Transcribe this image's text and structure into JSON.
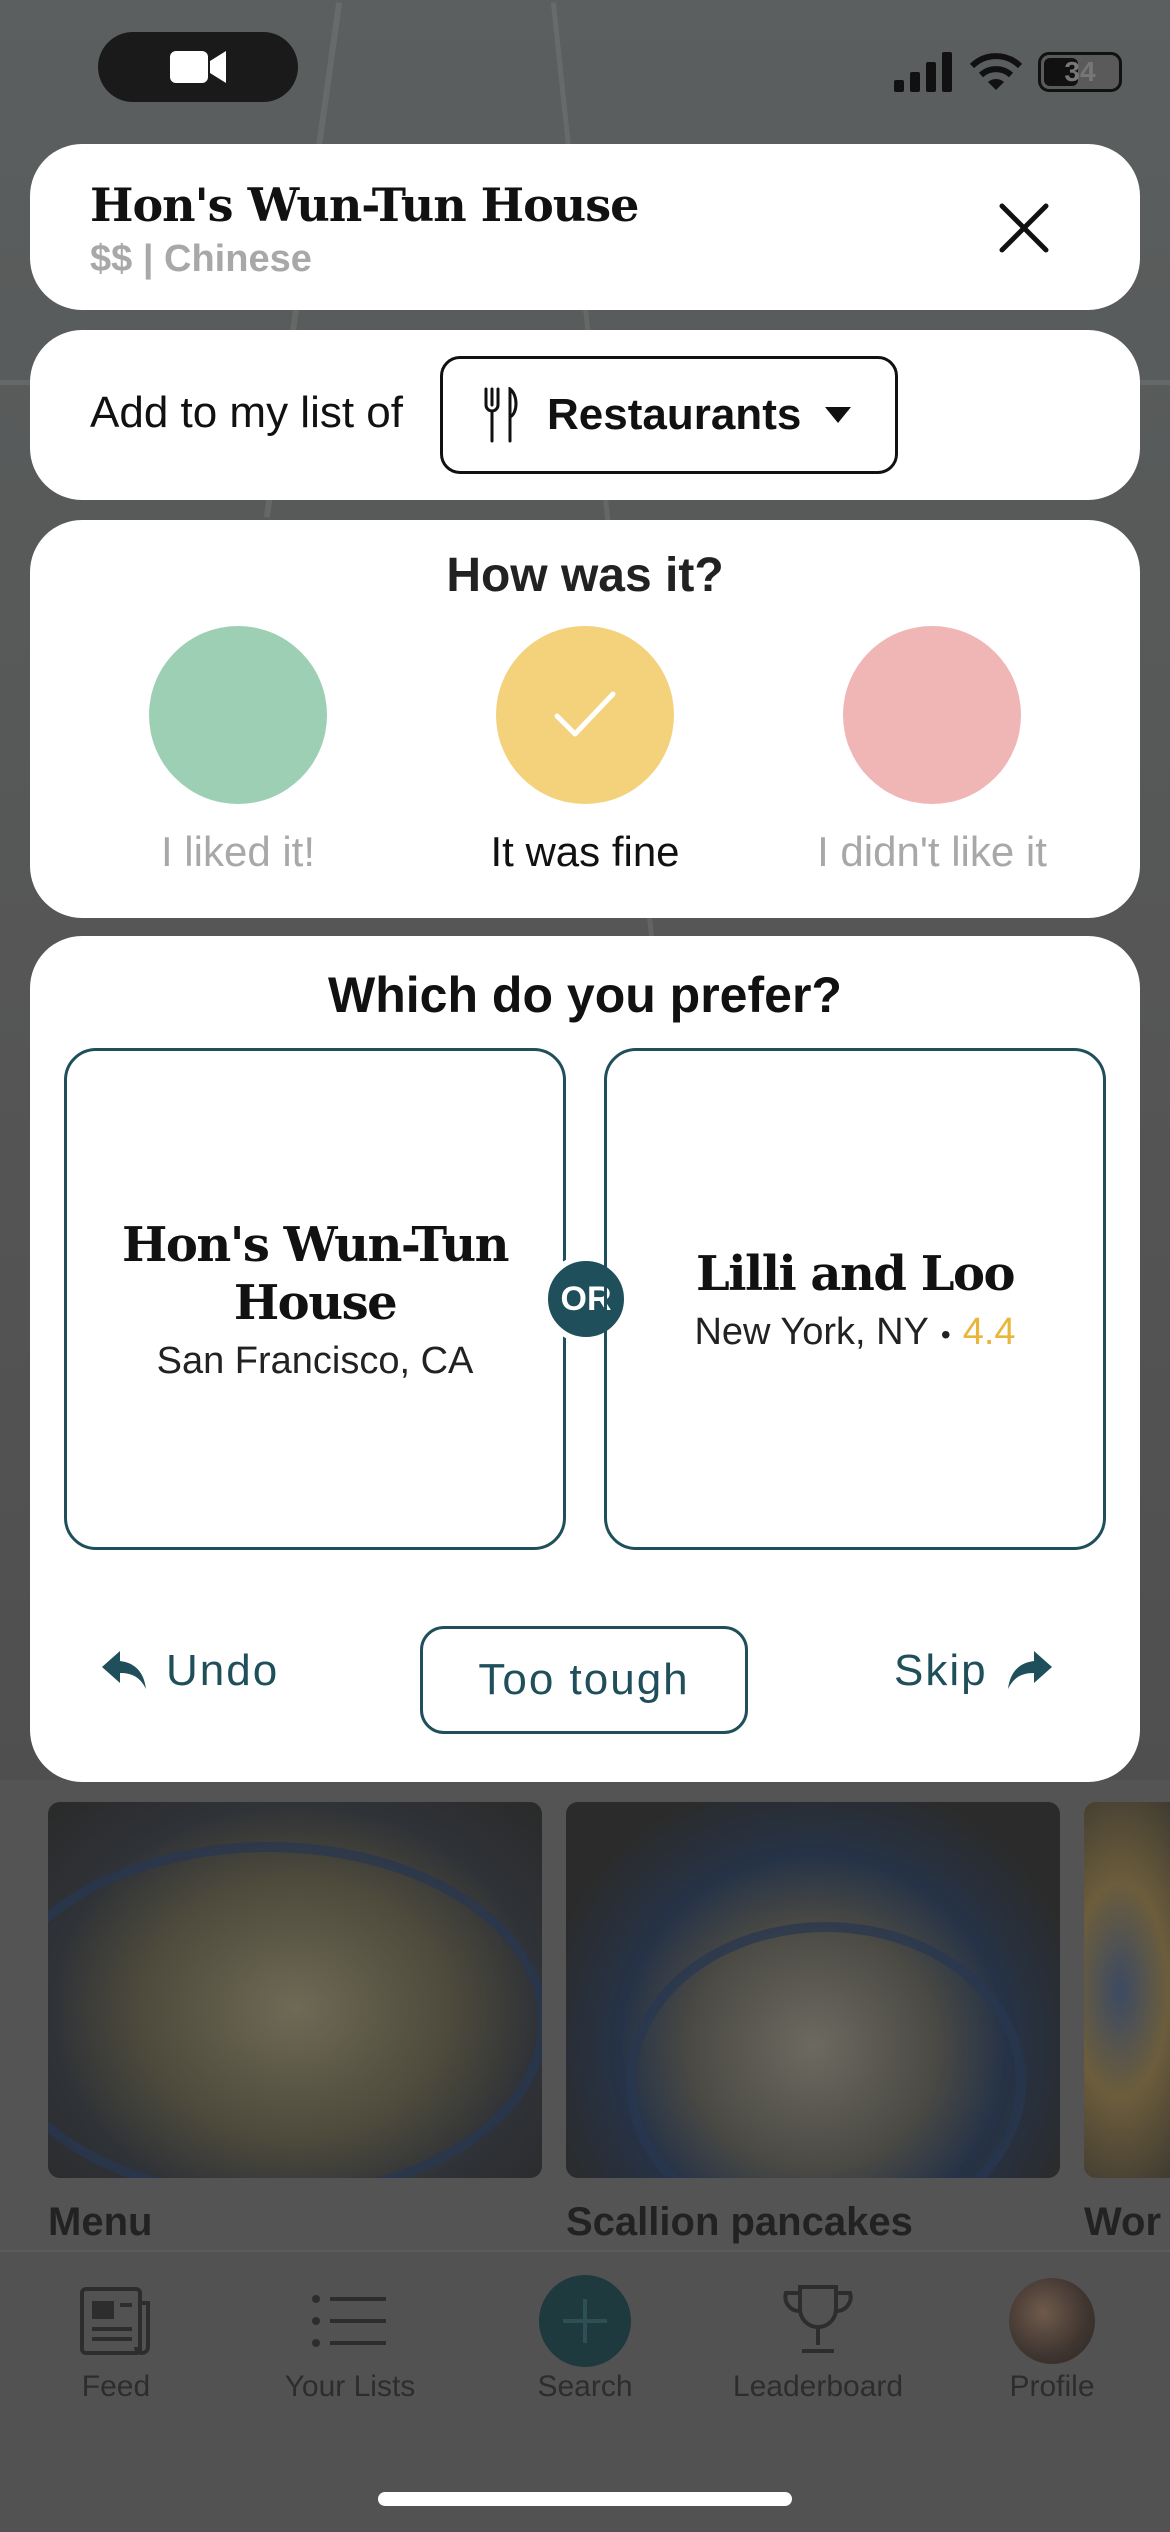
{
  "status_bar": {
    "battery": "34"
  },
  "header": {
    "restaurant_name": "Hon's Wun-Tun House",
    "subtitle": "$$ | Chinese"
  },
  "add_list": {
    "label": "Add to my list of",
    "selected": "Restaurants"
  },
  "rating": {
    "title": "How was it?",
    "options": [
      {
        "label": "I liked it!",
        "color": "#9ccfb4",
        "selected": false
      },
      {
        "label": "It was fine",
        "color": "#f3d27b",
        "selected": true
      },
      {
        "label": "I didn't like it",
        "color": "#f0b5b5",
        "selected": false
      }
    ]
  },
  "compare": {
    "title": "Which do you prefer?",
    "left": {
      "name": "Hon's Wun-Tun House",
      "location": "San Francisco, CA"
    },
    "or_label": "OR",
    "right": {
      "name": "Lilli and Loo",
      "location": "New York, NY",
      "score": "4.4"
    },
    "undo_label": "Undo",
    "too_tough_label": "Too tough",
    "skip_label": "Skip"
  },
  "background": {
    "photo_captions": [
      "Menu",
      "Scallion pancakes",
      "Wor"
    ]
  },
  "tabbar": {
    "tabs": [
      {
        "label": "Feed",
        "icon": "feed-icon"
      },
      {
        "label": "Your Lists",
        "icon": "list-icon"
      },
      {
        "label": "Search",
        "icon": "plus-icon"
      },
      {
        "label": "Leaderboard",
        "icon": "trophy-icon"
      },
      {
        "label": "Profile",
        "icon": "avatar"
      }
    ]
  },
  "colors": {
    "accent": "#1f4f5a",
    "score": "#e8b63c",
    "muted_text": "#a8a8a8"
  }
}
